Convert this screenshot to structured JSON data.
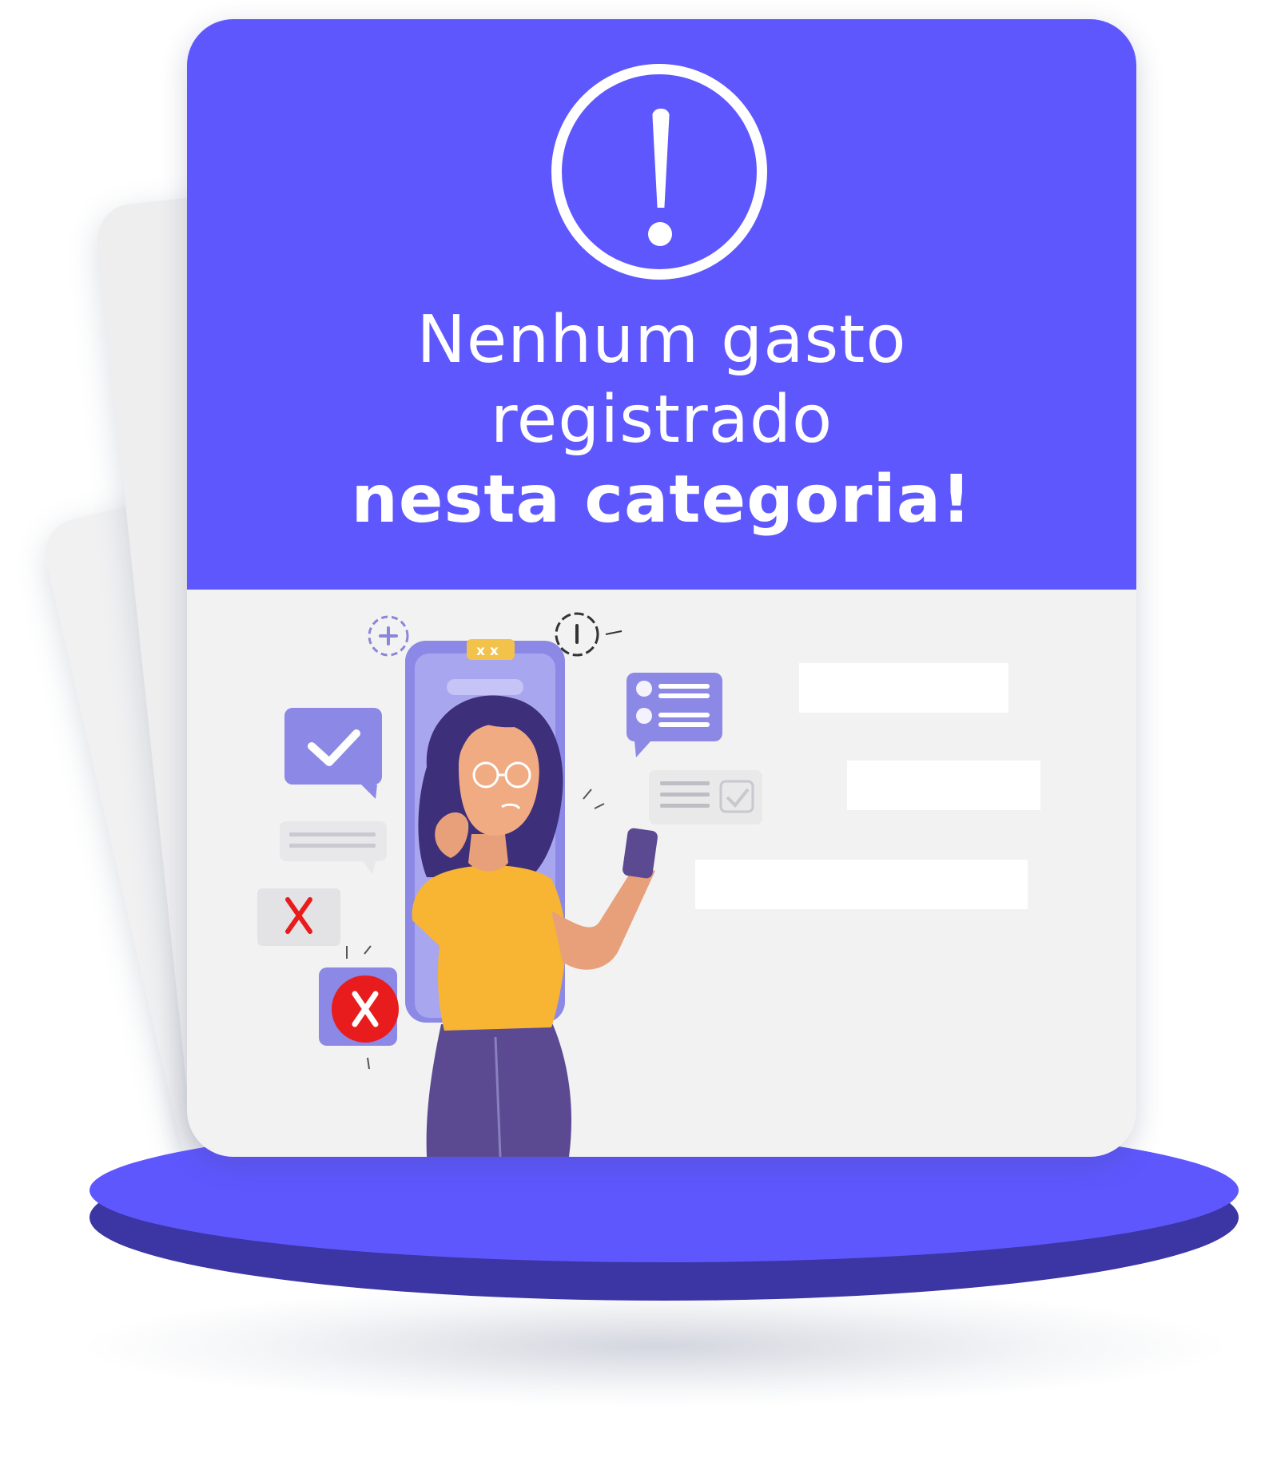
{
  "card": {
    "title_line1": "Nenhum gasto",
    "title_line2": "registrado",
    "title_line3": "nesta categoria!"
  },
  "icons": {
    "alert": "exclamation-circle-icon",
    "check": "checkmark-bubble-icon",
    "reject": "x-mark-icon",
    "reject_badge": "x-circle-badge-icon",
    "plus": "plus-circle-icon",
    "info": "info-circle-icon",
    "chat_list": "chat-list-bubble-icon",
    "receipt": "receipt-check-icon"
  },
  "colors": {
    "brand": "#5f57fe",
    "pedestal_side": "#3b36a3",
    "card_body": "#f3f2f2",
    "danger": "#e81c1c",
    "shirt": "#f7b533",
    "hair": "#3d2f79"
  }
}
